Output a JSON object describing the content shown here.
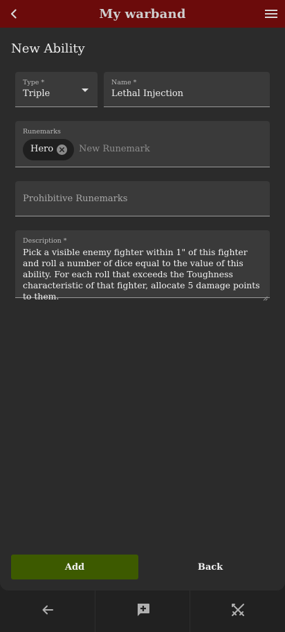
{
  "appbar": {
    "title": "My warband",
    "back_icon": "chevron-left-icon",
    "menu_icon": "hamburger-menu-icon",
    "bg_color": "#6b0b0b"
  },
  "page": {
    "title": "New Ability"
  },
  "form": {
    "type": {
      "label": "Type *",
      "value": "Triple"
    },
    "name": {
      "label": "Name *",
      "value": "Lethal Injection"
    },
    "runemarks": {
      "label": "Runemarks",
      "chips": [
        "Hero"
      ],
      "input_placeholder": "New Runemark"
    },
    "prohibitive_runemarks": {
      "placeholder": "Prohibitive Runemarks"
    },
    "description": {
      "label": "Description *",
      "value": "Pick a visible enemy fighter within 1\" of this fighter and roll a number of dice equal to the value of this ability. For each roll that exceeds the Toughness characteristic of that fighter, allocate 5 damage points to them."
    }
  },
  "actions": {
    "add_label": "Add",
    "back_label": "Back",
    "add_color": "#3d5a00"
  },
  "bottom_nav": {
    "items": [
      {
        "icon": "arrow-left-icon"
      },
      {
        "icon": "add-comment-icon"
      },
      {
        "icon": "crossed-swords-icon"
      }
    ]
  }
}
